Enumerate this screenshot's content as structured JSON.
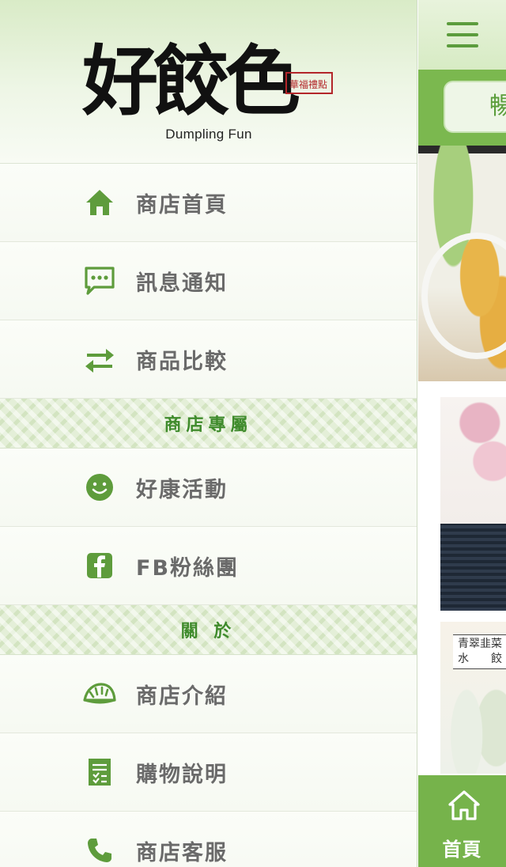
{
  "brand": {
    "logo_text": "好餃色",
    "seal_text": "華福禮點",
    "subtitle": "Dumpling Fun"
  },
  "menu": {
    "main": [
      {
        "label": "商店首頁",
        "icon": "home-icon"
      },
      {
        "label": "訊息通知",
        "icon": "chat-bubble-icon"
      },
      {
        "label": "商品比較",
        "icon": "swap-arrows-icon"
      }
    ],
    "section_store": {
      "title": "商店專屬",
      "items": [
        {
          "label": "好康活動",
          "icon": "smiley-icon"
        },
        {
          "label": "FB粉絲團",
          "icon": "facebook-icon"
        }
      ]
    },
    "section_about": {
      "title": "關 於",
      "items": [
        {
          "label": "商店介紹",
          "icon": "dumpling-icon"
        },
        {
          "label": "購物說明",
          "icon": "checklist-icon"
        },
        {
          "label": "商店客服",
          "icon": "phone-icon"
        }
      ]
    }
  },
  "content": {
    "tab_label": "暢",
    "product_tag_line1": "青翠韭菜",
    "product_tag_line2": "水　　餃"
  },
  "bottom_nav": {
    "home_label": "首頁",
    "home_icon": "home-icon"
  },
  "colors": {
    "accent_green": "#76b34b",
    "icon_green": "#5e9c3c",
    "label_gray": "#6a6a6a"
  }
}
